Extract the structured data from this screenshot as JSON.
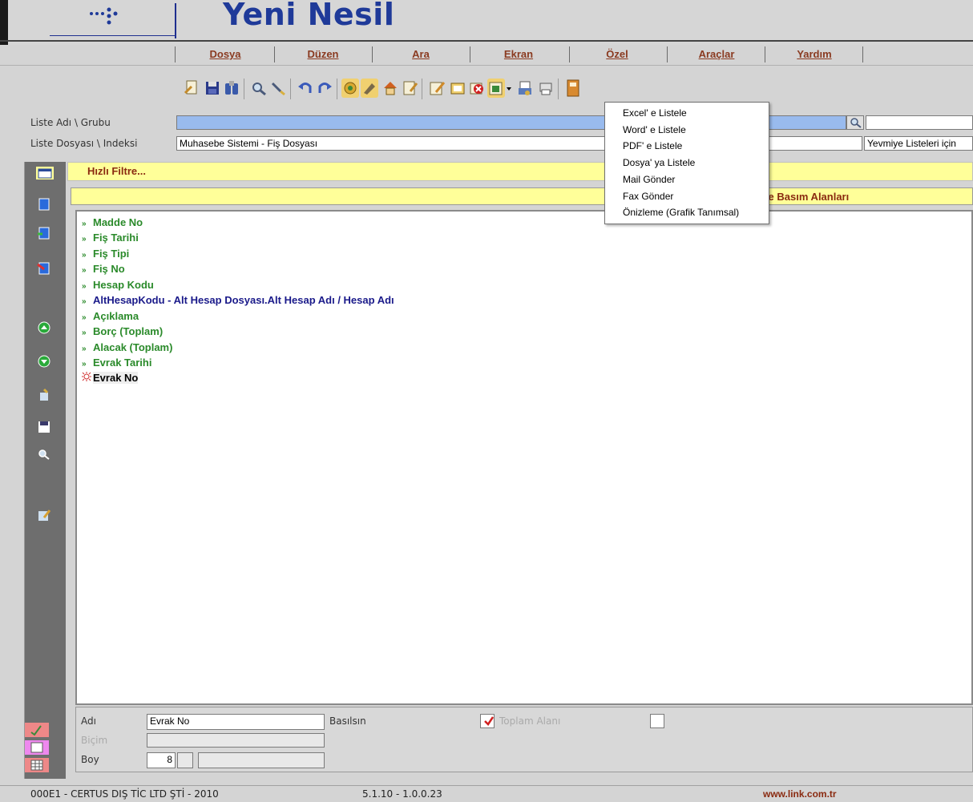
{
  "app": {
    "title": "Yeni Nesil"
  },
  "menu": [
    "Dosya",
    "Düzen",
    "Ara",
    "Ekran",
    "Özel",
    "Araçlar",
    "Yardım"
  ],
  "toolbar_icons": [
    "new-doc-icon",
    "save-icon",
    "binoculars-icon",
    "find-icon",
    "search-next-icon",
    "undo-icon",
    "redo-icon",
    "wizard-icon",
    "edit-icon",
    "home-icon",
    "note-icon",
    "report-icon",
    "folder-icon",
    "delete-icon",
    "export-icon",
    "dropdown-arrow-icon",
    "print-preview-icon",
    "print-icon",
    "exit-icon"
  ],
  "form": {
    "list_name_label": "Liste Adı \\ Grubu",
    "list_name_value": "",
    "list_file_label": "Liste Dosyası \\ Indeksi",
    "list_file_value": "Muhasebe Sistemi - Fiş Dosyası",
    "index_value": "Yevmiye Listeleri için"
  },
  "filter": {
    "label": "Hızlı Filtre..."
  },
  "print_fields": {
    "label": "ste Basım Alanları"
  },
  "fields": [
    {
      "text": "Madde No",
      "style": "green"
    },
    {
      "text": "Fiş Tarihi",
      "style": "green"
    },
    {
      "text": "Fiş Tipi",
      "style": "green"
    },
    {
      "text": "Fiş No",
      "style": "green"
    },
    {
      "text": "Hesap Kodu",
      "style": "green"
    },
    {
      "text": "AltHesapKodu - Alt Hesap Dosyası.Alt Hesap Adı / Hesap Adı",
      "style": "blue"
    },
    {
      "text": "Açıklama",
      "style": "green"
    },
    {
      "text": "Borç  (Toplam)",
      "style": "green"
    },
    {
      "text": "Alacak  (Toplam)",
      "style": "green"
    },
    {
      "text": "Evrak Tarihi",
      "style": "green"
    },
    {
      "text": "Evrak No",
      "style": "selected"
    }
  ],
  "bottom": {
    "name_label": "Adı",
    "name_value": "Evrak No",
    "printed_label": "Basılsın",
    "printed_checked": true,
    "total_label": "Toplam Alanı",
    "format_label": "Biçim",
    "format_value": "",
    "size_label": "Boy",
    "size_value": "8"
  },
  "status": {
    "company": "000E1 - CERTUS DIŞ TİC LTD ŞTİ - 2010",
    "version": "5.1.10 - 1.0.0.23",
    "website": "www.link.com.tr"
  },
  "dropdown": [
    "Excel' e Listele",
    "Word' e Listele",
    "PDF' e Listele",
    "Dosya' ya Listele",
    "Mail Gönder",
    "Fax Gönder",
    "Önizleme (Grafik Tanımsal)"
  ],
  "colors": {
    "brand": "#1f3a99",
    "menu": "#8a3a20",
    "highlight": "#ffff99",
    "green_field": "#2a8a2a",
    "blue_field": "#1a1a8a",
    "selection": "#99bbee"
  }
}
